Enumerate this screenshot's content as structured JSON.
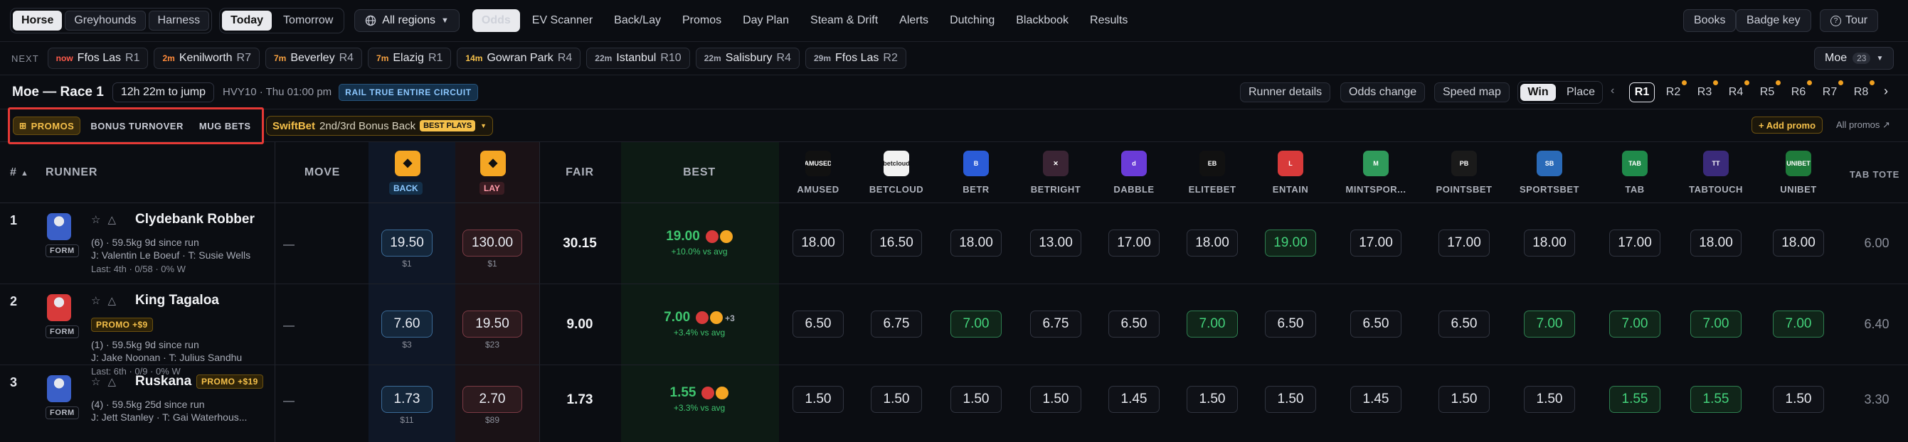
{
  "topbar": {
    "codes": [
      "Horse",
      "Greyhounds",
      "Harness"
    ],
    "days": [
      "Today",
      "Tomorrow"
    ],
    "regions": "All regions",
    "nav": [
      "Odds",
      "EV Scanner",
      "Back/Lay",
      "Promos",
      "Day Plan",
      "Steam & Drift",
      "Alerts",
      "Dutching",
      "Blackbook",
      "Results"
    ],
    "right": [
      "Books",
      "Badge key",
      "Tour"
    ]
  },
  "next": {
    "label": "NEXT",
    "races": [
      {
        "time": "now",
        "venue": "Ffos Las",
        "race": "R1",
        "color": "#ff5a4a"
      },
      {
        "time": "2m",
        "venue": "Kenilworth",
        "race": "R7",
        "color": "#ff8a3a"
      },
      {
        "time": "7m",
        "venue": "Beverley",
        "race": "R4",
        "color": "#f5a040"
      },
      {
        "time": "7m",
        "venue": "Elazig",
        "race": "R1",
        "color": "#f5a040"
      },
      {
        "time": "14m",
        "venue": "Gowran Park",
        "race": "R4",
        "color": "#f5c04a"
      },
      {
        "time": "22m",
        "venue": "Istanbul",
        "race": "R10",
        "color": "#a7abb6"
      },
      {
        "time": "22m",
        "venue": "Salisbury",
        "race": "R4",
        "color": "#a7abb6"
      },
      {
        "time": "29m",
        "venue": "Ffos Las",
        "race": "R2",
        "color": "#a7abb6"
      }
    ],
    "venue_select": "Moe",
    "venue_count": "23"
  },
  "race": {
    "title": "Moe — Race 1",
    "countdown": "12h 22m to jump",
    "meta": "HVY10 · Thu 01:00 pm",
    "rail": "RAIL TRUE ENTIRE CIRCUIT",
    "buttons": [
      "Runner details",
      "Odds change",
      "Speed map"
    ],
    "win": "Win",
    "place": "Place",
    "races": [
      "R1",
      "R2",
      "R3",
      "R4",
      "R5",
      "R6",
      "R7",
      "R8"
    ]
  },
  "promos": {
    "tabs": [
      "PROMOS",
      "BONUS TURNOVER",
      "MUG BETS"
    ],
    "swift_book": "SwiftBet",
    "swift_text": "2nd/3rd Bonus Back",
    "swift_badge": "BEST PLAYS",
    "add": "+ Add promo",
    "all": "All promos"
  },
  "table": {
    "headers": {
      "num": "#",
      "runner": "RUNNER",
      "move": "MOVE",
      "back": "BACK",
      "lay": "LAY",
      "fair": "FAIR",
      "best": "BEST",
      "tote": "TAB TOTE"
    },
    "books": [
      {
        "name": "AMUSED",
        "logo": "AMUSED",
        "color": "#111111"
      },
      {
        "name": "BETCLOUD",
        "logo": "betcloud",
        "color": "#f2f2f2"
      },
      {
        "name": "BETR",
        "logo": "B",
        "color": "#2a5bd7"
      },
      {
        "name": "BETRIGHT",
        "logo": "✕",
        "color": "#3a2434"
      },
      {
        "name": "DABBLE",
        "logo": "d",
        "color": "#6a3bd8"
      },
      {
        "name": "ELITEBET",
        "logo": "EB",
        "color": "#111111"
      },
      {
        "name": "ENTAIN",
        "logo": "L",
        "color": "#d83a3a"
      },
      {
        "name": "MINTSPOR...",
        "logo": "M",
        "color": "#2f9a5a"
      },
      {
        "name": "POINTSBET",
        "logo": "PB",
        "color": "#1a1a1a"
      },
      {
        "name": "SPORTSBET",
        "logo": "SB",
        "color": "#2a6ab8"
      },
      {
        "name": "TAB",
        "logo": "TAB",
        "color": "#1f8a4a"
      },
      {
        "name": "TABTOUCH",
        "logo": "TT",
        "color": "#3a2a7a"
      },
      {
        "name": "UNIBET",
        "logo": "UNIBET",
        "color": "#1e7a3a"
      }
    ],
    "runners": [
      {
        "num": "1",
        "name": "Clydebank Robber",
        "form_label": "FORM",
        "info": "(6) · 59.5kg   9d since run",
        "jockey": "J: Valentin Le Boeuf  ·  T: Susie Wells",
        "last": "Last: 4th · 0/58 · 0% W",
        "promo": "",
        "move": "—",
        "back": "19.50",
        "back_sub": "$1",
        "lay": "130.00",
        "lay_sub": "$1",
        "fair": "30.15",
        "best": "19.00",
        "best_sub": "+10.0% vs avg",
        "best_extra": "",
        "odds": [
          "18.00",
          "16.50",
          "18.00",
          "13.00",
          "17.00",
          "18.00",
          "19.00",
          "17.00",
          "17.00",
          "18.00",
          "17.00",
          "18.00",
          "18.00"
        ],
        "highlight": [
          6
        ],
        "tote": "6.00",
        "silk": "#3a5fc8"
      },
      {
        "num": "2",
        "name": "King Tagaloa",
        "form_label": "FORM",
        "info": "(1) · 59.5kg   9d since run",
        "jockey": "J: Jake Noonan  ·  T: Julius Sandhu",
        "last": "Last: 6th · 0/9 · 0% W",
        "promo": "PROMO +$9",
        "move": "—",
        "back": "7.60",
        "back_sub": "$3",
        "lay": "19.50",
        "lay_sub": "$23",
        "fair": "9.00",
        "best": "7.00",
        "best_sub": "+3.4% vs avg",
        "best_extra": "+3",
        "odds": [
          "6.50",
          "6.75",
          "7.00",
          "6.75",
          "6.50",
          "7.00",
          "6.50",
          "6.50",
          "6.50",
          "7.00",
          "7.00",
          "7.00",
          "7.00"
        ],
        "highlight": [
          2,
          5,
          9,
          10,
          11,
          12
        ],
        "tote": "6.40",
        "silk": "#d83a3a"
      },
      {
        "num": "3",
        "name": "Ruskana",
        "form_label": "FORM",
        "info": "(4) · 59.5kg   25d since run",
        "jockey": "J: Jett Stanley  ·  T: Gai Waterhous...",
        "last": "",
        "promo": "PROMO +$19",
        "move": "—",
        "back": "1.73",
        "back_sub": "$11",
        "lay": "2.70",
        "lay_sub": "$89",
        "fair": "1.73",
        "best": "1.55",
        "best_sub": "+3.3% vs avg",
        "best_extra": "",
        "odds": [
          "1.50",
          "1.50",
          "1.50",
          "1.50",
          "1.45",
          "1.50",
          "1.50",
          "1.45",
          "1.50",
          "1.50",
          "1.55",
          "1.55",
          "1.50"
        ],
        "highlight": [
          10,
          11
        ],
        "tote": "3.30",
        "silk": "#3a5fc8"
      }
    ]
  }
}
